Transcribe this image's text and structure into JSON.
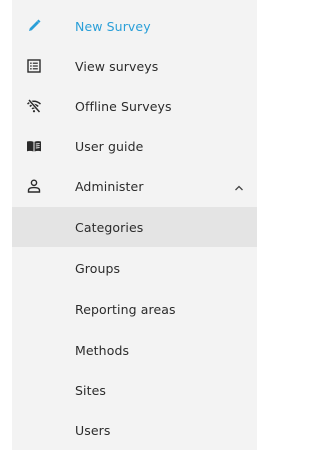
{
  "nav": {
    "primary": [
      {
        "label": "New Survey",
        "icon": "pencil-icon",
        "active": true
      },
      {
        "label": "View surveys",
        "icon": "list-icon"
      },
      {
        "label": "Offline Surveys",
        "icon": "wifi-off-icon"
      },
      {
        "label": "User guide",
        "icon": "book-icon"
      },
      {
        "label": "Administer",
        "icon": "user-icon",
        "expanded": true
      }
    ],
    "administer_items": [
      {
        "label": "Categories",
        "selected": true
      },
      {
        "label": "Groups"
      },
      {
        "label": "Reporting areas"
      },
      {
        "label": "Methods"
      },
      {
        "label": "Sites"
      },
      {
        "label": "Users"
      }
    ]
  },
  "colors": {
    "accent": "#2a9fd8",
    "panel_bg": "#f3f3f3",
    "selected_bg": "#e4e4e4",
    "text": "#2b2b2b"
  }
}
